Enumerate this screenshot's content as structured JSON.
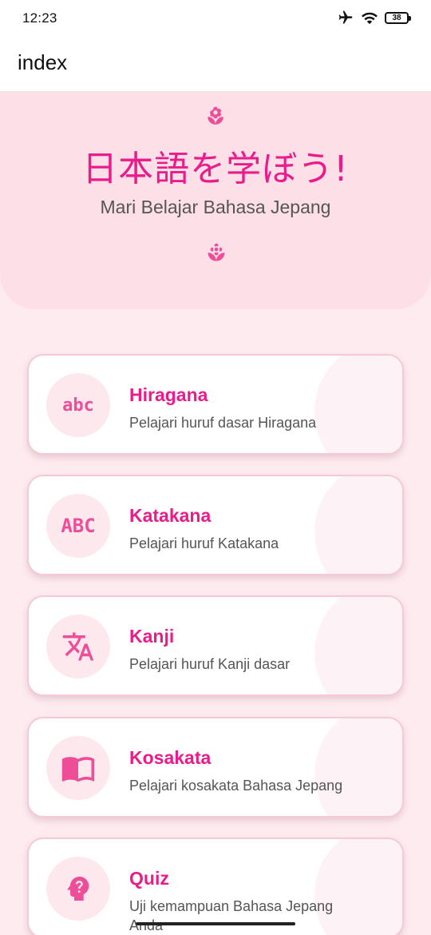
{
  "status": {
    "time": "12:23",
    "battery": "38",
    "icons": [
      "airplane-icon",
      "wifi-icon",
      "battery-icon"
    ]
  },
  "app_bar": {
    "title": "index"
  },
  "hero": {
    "title": "日本語を学ぼう!",
    "subtitle": "Mari Belajar Bahasa Jepang",
    "icons": [
      "flower-icon",
      "flower-icon"
    ]
  },
  "colors": {
    "accent": "#ea1b8b",
    "icon_pink": "#ee4d98",
    "hero_bg": "#fde0e7",
    "page_bg": "#fdebf0",
    "card_border": "#f6c9d6"
  },
  "menu": [
    {
      "title": "Hiragana",
      "description": "Pelajari huruf dasar Hiragana",
      "icon": "abc-icon",
      "icon_text": "abc"
    },
    {
      "title": "Katakana",
      "description": "Pelajari huruf Katakana",
      "icon": "abc-uppercase-icon",
      "icon_text": "ABC"
    },
    {
      "title": "Kanji",
      "description": "Pelajari huruf Kanji dasar",
      "icon": "translate-icon"
    },
    {
      "title": "Kosakata",
      "description": "Pelajari kosakata Bahasa Jepang",
      "icon": "book-icon"
    },
    {
      "title": "Quiz",
      "description": "Uji kemampuan Bahasa Jepang Anda",
      "icon": "psychology-icon"
    }
  ]
}
